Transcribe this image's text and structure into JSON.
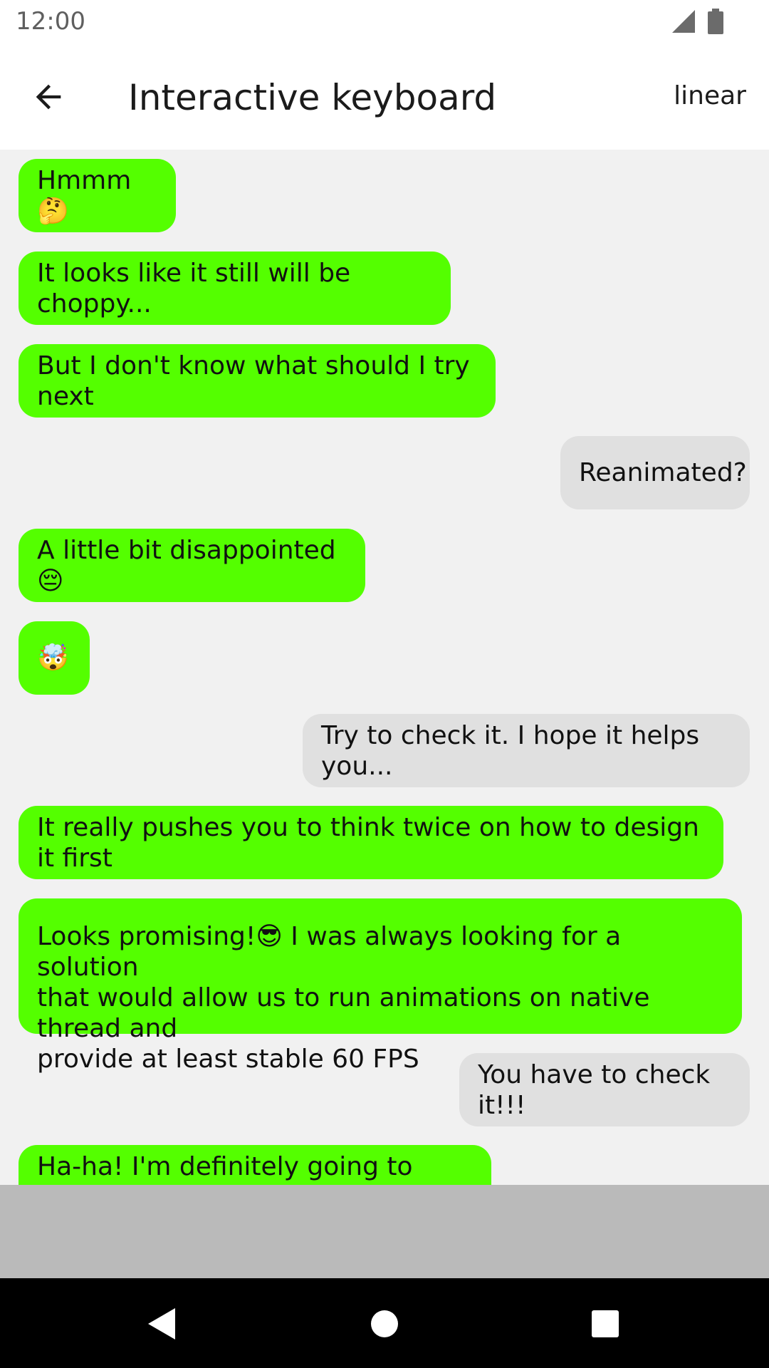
{
  "status_bar": {
    "time": "12:00",
    "signal_icon": "signal-icon",
    "battery_icon": "battery-icon"
  },
  "app_bar": {
    "back_icon": "arrow-left-icon",
    "title": "Interactive keyboard",
    "mode_label": "linear"
  },
  "colors": {
    "mine_bubble": "#54ff00",
    "their_bubble": "#e0e0e0",
    "background": "#f1f1f1",
    "input_bar": "#bababa"
  },
  "messages": [
    {
      "text": "Hmmm🤔",
      "sender": "me"
    },
    {
      "text": "It looks like it still will be choppy...",
      "sender": "me"
    },
    {
      "text": "But I don't know what should I try next",
      "sender": "me"
    },
    {
      "text": "Reanimated?",
      "sender": "other"
    },
    {
      "text": "A little bit disappointed 😔",
      "sender": "me"
    },
    {
      "text": "🤯",
      "sender": "me"
    },
    {
      "text": "Try to check it. I hope it helps you...",
      "sender": "other"
    },
    {
      "text": "It really pushes you to think twice on how to design it first",
      "sender": "me"
    },
    {
      "text": "Looks promising!😎 I was always looking for a solution\nthat would allow us to run animations on native thread and\nprovide at least stable 60 FPS",
      "sender": "me"
    },
    {
      "text": "You have to check it!!!",
      "sender": "other"
    },
    {
      "text": "Ha-ha! I'm definitely going to check it!",
      "sender": "me"
    }
  ],
  "nav_bar": {
    "back_icon": "nav-back-triangle-icon",
    "home_icon": "nav-home-circle-icon",
    "recents_icon": "nav-recents-square-icon"
  }
}
